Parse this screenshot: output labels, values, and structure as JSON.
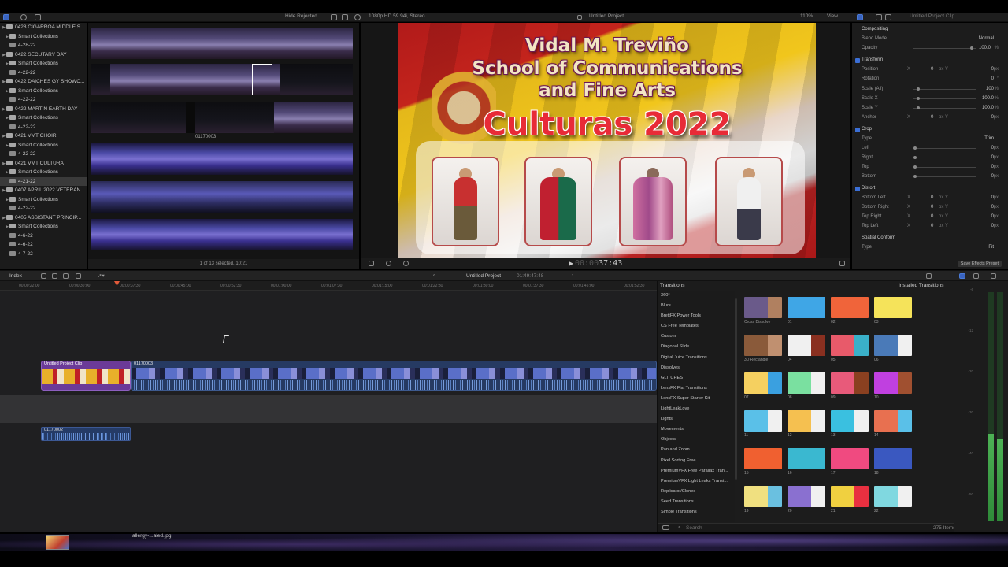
{
  "topbar": {
    "filter": "Hide Rejected",
    "format": "1080p HD 59.94i, Stereo",
    "project": "Untitled Project",
    "zoom": "110%",
    "view": "View",
    "inspector_title": "Untitled Project Clip"
  },
  "library": {
    "items": [
      {
        "label": "0428 CIGARROA MIDDLE S...",
        "level": 0,
        "folder": true
      },
      {
        "label": "Smart Collections",
        "level": 1,
        "folder": true
      },
      {
        "label": "4-28-22",
        "level": 1,
        "folder": false
      },
      {
        "label": "0422 SECUTARY DAY",
        "level": 0,
        "folder": true
      },
      {
        "label": "Smart Collections",
        "level": 1,
        "folder": true
      },
      {
        "label": "4-22-22",
        "level": 1,
        "folder": false
      },
      {
        "label": "0422 DAICHES GY SHOWC...",
        "level": 0,
        "folder": true
      },
      {
        "label": "Smart Collections",
        "level": 1,
        "folder": true
      },
      {
        "label": "4-22-22",
        "level": 1,
        "folder": false
      },
      {
        "label": "0422 MARTIN EARTH DAY",
        "level": 0,
        "folder": true
      },
      {
        "label": "Smart Collections",
        "level": 1,
        "folder": true
      },
      {
        "label": "4-22-22",
        "level": 1,
        "folder": false
      },
      {
        "label": "0421 VMT CHOIR",
        "level": 0,
        "folder": true
      },
      {
        "label": "Smart Collections",
        "level": 1,
        "folder": true
      },
      {
        "label": "4-22-22",
        "level": 1,
        "folder": false
      },
      {
        "label": "0421 VMT CULTURA",
        "level": 0,
        "folder": true
      },
      {
        "label": "Smart Collections",
        "level": 1,
        "folder": true
      },
      {
        "label": "4-21-22",
        "level": 1,
        "folder": false,
        "selected": true
      },
      {
        "label": "0407 APRIL 2022 VETERAN",
        "level": 0,
        "folder": true
      },
      {
        "label": "Smart Collections",
        "level": 1,
        "folder": true
      },
      {
        "label": "4-22-22",
        "level": 1,
        "folder": false
      },
      {
        "label": "0405 ASSISTANT PRINCIP...",
        "level": 0,
        "folder": true
      },
      {
        "label": "Smart Collections",
        "level": 1,
        "folder": true
      },
      {
        "label": "4-6-22",
        "level": 1,
        "folder": false
      },
      {
        "label": "4-6-22",
        "level": 1,
        "folder": false
      },
      {
        "label": "4-7-22",
        "level": 1,
        "folder": false
      }
    ]
  },
  "browser": {
    "clip_label": "01170003",
    "status": "1 of 13 selected, 10:21"
  },
  "viewer": {
    "title_line1": "Vidal M. Treviño",
    "title_line2": "School of Communications",
    "title_line3": "and Fine Arts",
    "title_line4": "Culturas 2022",
    "timecode_dim": "00:00",
    "timecode": "37:43"
  },
  "inspector": {
    "compositing": "Compositing",
    "blend_mode_label": "Blend Mode",
    "blend_mode_value": "Normal",
    "opacity_label": "Opacity",
    "opacity_value": "100.0",
    "opacity_unit": "%",
    "transform": "Transform",
    "position_label": "Position",
    "rotation_label": "Rotation",
    "rotation_value": "0",
    "rotation_unit": "°",
    "scale_all_label": "Scale (All)",
    "scale_all_value": "100",
    "scale_x_label": "Scale X",
    "scale_x_value": "100.0",
    "scale_y_label": "Scale Y",
    "scale_y_value": "100.0",
    "anchor_label": "Anchor",
    "crop": "Crop",
    "type_label": "Type",
    "crop_type_value": "Trim",
    "left_label": "Left",
    "right_label": "Right",
    "top_label": "Top",
    "bottom_label": "Bottom",
    "distort": "Distort",
    "bottom_left_label": "Bottom Left",
    "bottom_right_label": "Bottom Right",
    "top_right_label": "Top Right",
    "top_left_label": "Top Left",
    "spatial_conform": "Spatial Conform",
    "conform_type_value": "Fit",
    "zero": "0",
    "px": "px",
    "x": "X",
    "y": "Y",
    "save_preset": "Save Effects Preset"
  },
  "timeline_header": {
    "index": "Index",
    "project": "Untitled Project",
    "duration": "01:49:47:48"
  },
  "ruler_ticks": [
    "00:00:22:00",
    "00:00:30:00",
    "00:00:37:30",
    "00:00:45:00",
    "00:00:52:30",
    "00:01:00:00",
    "00:01:07:30",
    "00:01:15:00",
    "00:01:22:30",
    "00:01:30:00",
    "00:01:37:30",
    "00:01:45:00",
    "00:01:52:30"
  ],
  "timeline": {
    "compound_clip": "Untitled Project Clip",
    "video_clip": "01170003",
    "audio_clip": "01170002"
  },
  "transitions": {
    "title": "Transitions",
    "installed": "Installed Transitions",
    "categories": [
      "360°",
      "Blurs",
      "BrettFX Power Tools",
      "CS Free Templates",
      "Custom",
      "Diagonal Slide",
      "Digital Juice Transitions",
      "Dissolves",
      "GLITCHES",
      "LensFX Flat Transitions",
      "LensFX Super Starter Kit",
      "LightLeakLove",
      "Lights",
      "Movements",
      "Objects",
      "Pan and Zoom",
      "Pixel Sorting Free",
      "PremiumVFX Free Parallax Tran...",
      "PremiumVFX Light Leaks Transi...",
      "Replicator/Clones",
      "Seed Transitions",
      "Simple Transitions"
    ],
    "tiles": [
      {
        "label": "Cross Dissolve",
        "colors": [
          "#6a5a8a",
          "#b08060"
        ]
      },
      {
        "label": "01",
        "colors": [
          "#3fa6e6",
          "#3fa6e6"
        ]
      },
      {
        "label": "02",
        "colors": [
          "#f0643a",
          "#f0643a"
        ]
      },
      {
        "label": "03",
        "colors": [
          "#f5e35a",
          "#f5e35a"
        ]
      },
      {
        "label": "3D Rectangle",
        "colors": [
          "#8a5a3a",
          "#c09070"
        ]
      },
      {
        "label": "04",
        "colors": [
          "#f0f0f0",
          "#8a3020"
        ]
      },
      {
        "label": "05",
        "colors": [
          "#e85a6a",
          "#3ab0c8"
        ]
      },
      {
        "label": "06",
        "colors": [
          "#4a7ab8",
          "#f0f0f0"
        ]
      },
      {
        "label": "07",
        "colors": [
          "#f5d060",
          "#3aa0e0"
        ]
      },
      {
        "label": "08",
        "colors": [
          "#7ae0a0",
          "#f0f0f0"
        ]
      },
      {
        "label": "09",
        "colors": [
          "#e85a7a",
          "#8a4020"
        ]
      },
      {
        "label": "10",
        "colors": [
          "#c040e0",
          "#a05030"
        ]
      },
      {
        "label": "11",
        "colors": [
          "#5ac0e8",
          "#f0f0f0"
        ]
      },
      {
        "label": "12",
        "colors": [
          "#f5c050",
          "#f0f0f0"
        ]
      },
      {
        "label": "13",
        "colors": [
          "#3ac0e0",
          "#f0f0f0"
        ]
      },
      {
        "label": "14",
        "colors": [
          "#e87050",
          "#5ac0e8"
        ]
      },
      {
        "label": "15",
        "colors": [
          "#f06030",
          "#f06030"
        ]
      },
      {
        "label": "16",
        "colors": [
          "#3ab8d0",
          "#3ab8d0"
        ]
      },
      {
        "label": "17",
        "colors": [
          "#f04a80",
          "#f04a80"
        ]
      },
      {
        "label": "18",
        "colors": [
          "#3a58c0",
          "#3a58c0"
        ]
      },
      {
        "label": "19",
        "colors": [
          "#f0e080",
          "#6ac0e0"
        ]
      },
      {
        "label": "20",
        "colors": [
          "#8a70d0",
          "#f0f0f0"
        ]
      },
      {
        "label": "21",
        "colors": [
          "#f0d040",
          "#e83040"
        ]
      },
      {
        "label": "22",
        "colors": [
          "#80d8e0",
          "#f0f0f0"
        ]
      }
    ],
    "search_placeholder": "Search",
    "count": "275 Items"
  },
  "meters": {
    "ticks": [
      "-6",
      "-12",
      "-20",
      "-30",
      "-40",
      "-50"
    ],
    "level_left": 0.38,
    "level_right": 0.36
  },
  "dock": {
    "filename": "allergy-...aled.jpg"
  },
  "colors": {
    "playhead": "#e25a3a",
    "selection_blue": "#3b6fd6"
  }
}
